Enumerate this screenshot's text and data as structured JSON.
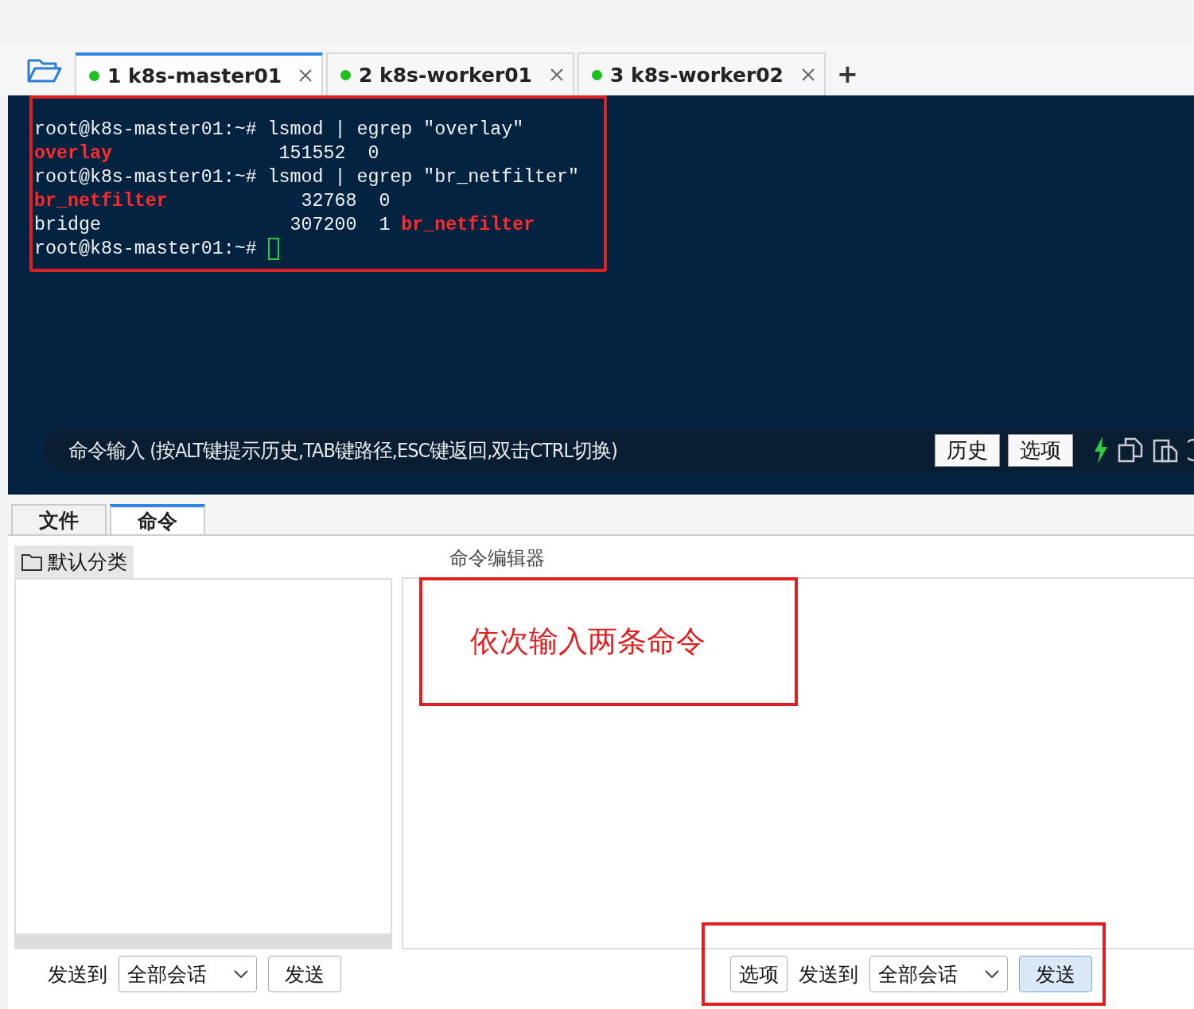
{
  "session_tabs": [
    {
      "number": "1",
      "label": "k8s-master01",
      "selected": true,
      "connected": true
    },
    {
      "number": "2",
      "label": "k8s-worker01",
      "selected": false,
      "connected": true
    },
    {
      "number": "3",
      "label": "k8s-worker02",
      "selected": false,
      "connected": true
    }
  ],
  "add_tab": "+",
  "terminal": {
    "lines": [
      [
        {
          "text": "root@k8s-master01:~# lsmod | egrep \"overlay\"",
          "kind": "plain"
        }
      ],
      [
        {
          "text": "overlay",
          "kind": "match"
        },
        {
          "text": "               151552  0",
          "kind": "plain"
        }
      ],
      [
        {
          "text": "root@k8s-master01:~# lsmod | egrep \"br_netfilter\"",
          "kind": "plain"
        }
      ],
      [
        {
          "text": "br_netfilter",
          "kind": "match"
        },
        {
          "text": "            32768  0",
          "kind": "plain"
        }
      ],
      [
        {
          "text": "bridge                 307200  1 ",
          "kind": "plain"
        },
        {
          "text": "br_netfilter",
          "kind": "match"
        }
      ],
      [
        {
          "text": "root@k8s-master01:~# ",
          "kind": "plain"
        }
      ]
    ],
    "cursor": true,
    "command_input": {
      "placeholder": "命令输入 (按ALT键提示历史,TAB键路径,ESC键返回,双击CTRL切换)",
      "buttons": [
        "历史",
        "选项"
      ]
    }
  },
  "panel_tabs": [
    {
      "label": "文件",
      "selected": false
    },
    {
      "label": "命令",
      "selected": true
    }
  ],
  "category": "默认分类",
  "editor_title": "命令编辑器",
  "annotation": "依次输入两条命令",
  "left_send": {
    "label": "发送到",
    "target": "全部会话",
    "button": "发送"
  },
  "right_send": {
    "options": "选项",
    "label": "发送到",
    "target": "全部会话",
    "button": "发送"
  }
}
